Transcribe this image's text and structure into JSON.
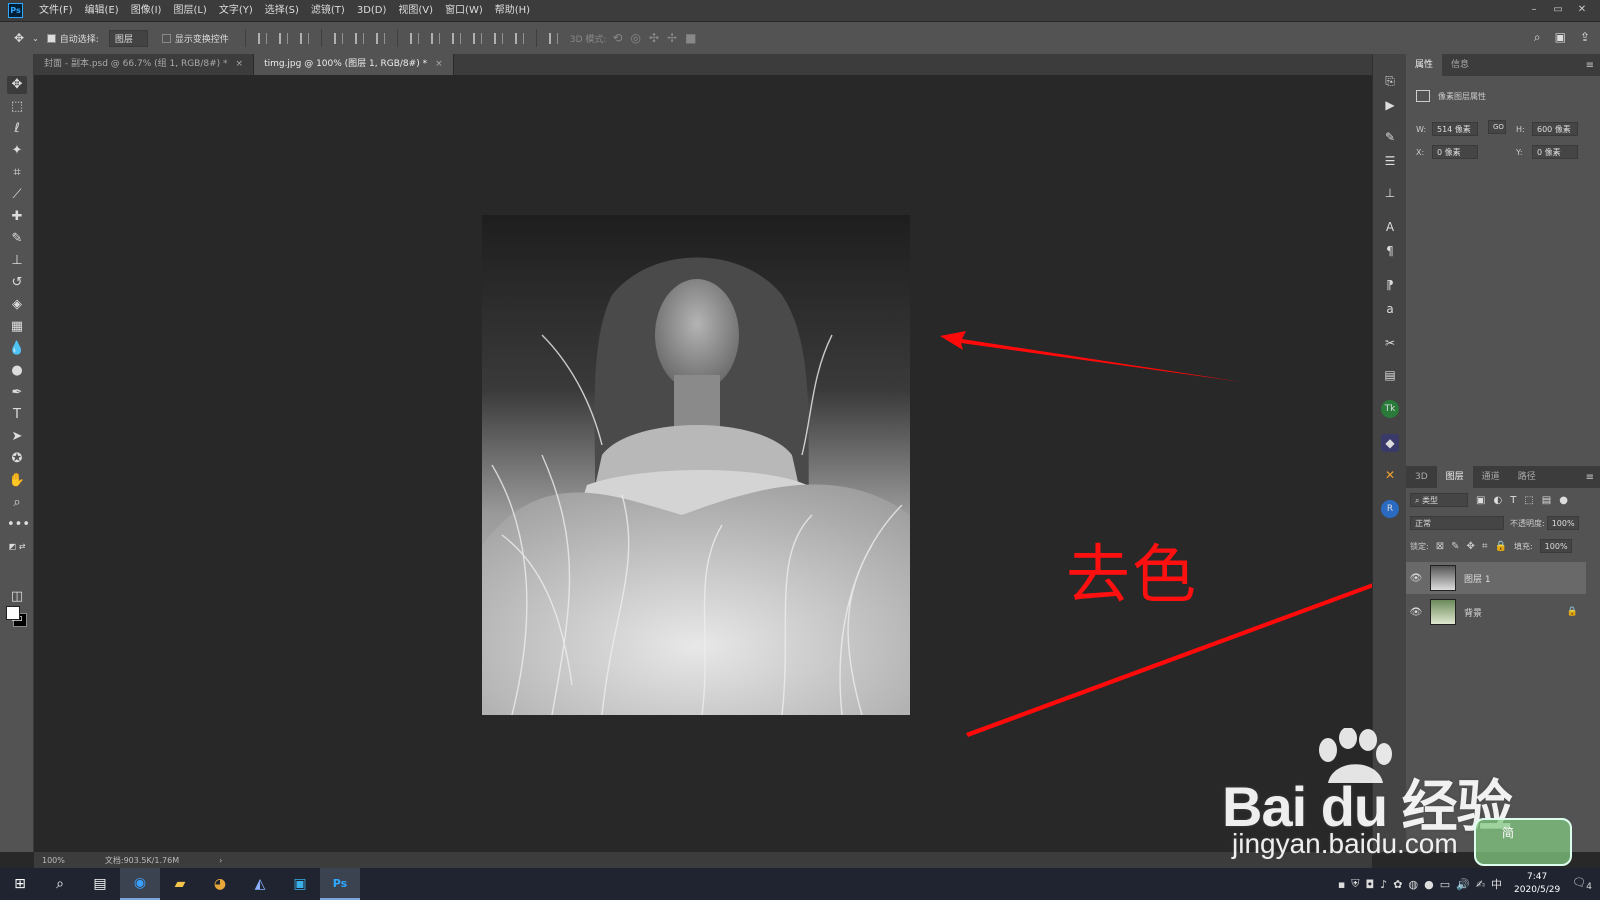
{
  "menubar": {
    "app_badge": "Ps",
    "items": [
      "文件(F)",
      "编辑(E)",
      "图像(I)",
      "图层(L)",
      "文字(Y)",
      "选择(S)",
      "滤镜(T)",
      "3D(D)",
      "视图(V)",
      "窗口(W)",
      "帮助(H)"
    ],
    "window_controls": [
      "–",
      "▭",
      "✕"
    ]
  },
  "options": {
    "auto_select_label": "自动选择:",
    "auto_select_value": "图层",
    "show_transform_label": "显示变换控件",
    "mode_3d_label": "3D 模式:"
  },
  "tabs": [
    {
      "label": "封面 - 副本.psd @ 66.7% (组 1, RGB/8#) *",
      "close": "×"
    },
    {
      "label": "timg.jpg @ 100% (图层 1, RGB/8#) *",
      "close": "×"
    }
  ],
  "status": {
    "zoom": "100%",
    "doc": "文档:903.5K/1.76M",
    "arrow": "›"
  },
  "properties": {
    "tabs": [
      "属性",
      "信息"
    ],
    "title": "像素图层属性",
    "w_label": "W:",
    "w_value": "514 像素",
    "link_label": "GO",
    "h_label": "H:",
    "h_value": "600 像素",
    "x_label": "X:",
    "x_value": "0 像素",
    "y_label": "Y:",
    "y_value": "0 像素"
  },
  "layers": {
    "tabs": [
      "3D",
      "图层",
      "通道",
      "路径"
    ],
    "filter_label": "类型",
    "blend_mode": "正常",
    "opacity_label": "不透明度:",
    "opacity_value": "100%",
    "lock_label": "锁定:",
    "fill_label": "填充:",
    "fill_value": "100%",
    "items": [
      {
        "name": "图层 1"
      },
      {
        "name": "背景"
      }
    ]
  },
  "annotation": {
    "text": "去色",
    "color": "#ff1010"
  },
  "watermark": {
    "main": "Bai du 经验",
    "url": "jingyan.baidu.com",
    "badge": "简"
  },
  "taskbar": {
    "time": "7:47",
    "date": "2020/5/29",
    "ime": "中",
    "notifications": "4"
  },
  "colors": {
    "accent": "#31a8ff",
    "panel": "#535353",
    "canvas": "#282828"
  }
}
